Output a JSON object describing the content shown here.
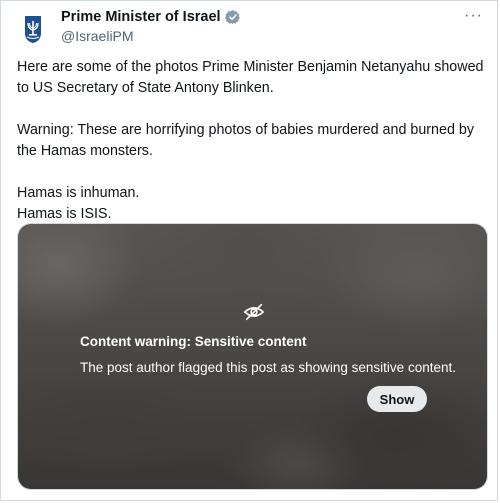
{
  "author": {
    "name": "Prime Minister of Israel",
    "handle": "@IsraeliPM",
    "verified_badge": "verified-badge",
    "more_label": "···"
  },
  "post": {
    "lines": [
      "Here are some of the photos Prime Minister Benjamin Netanyahu showed to US Secretary of State Antony Blinken.",
      "Warning: These are horrifying photos of babies murdered and burned by the Hamas monsters.",
      "Hamas is inhuman.",
      "Hamas is ISIS."
    ]
  },
  "media": {
    "warning_title": "Content warning: Sensitive content",
    "warning_description": "The post author flagged this post as showing sensitive content.",
    "show_label": "Show"
  },
  "colors": {
    "verified_badge": "#829aab",
    "text_primary": "#0f1419",
    "text_secondary": "#536471"
  }
}
